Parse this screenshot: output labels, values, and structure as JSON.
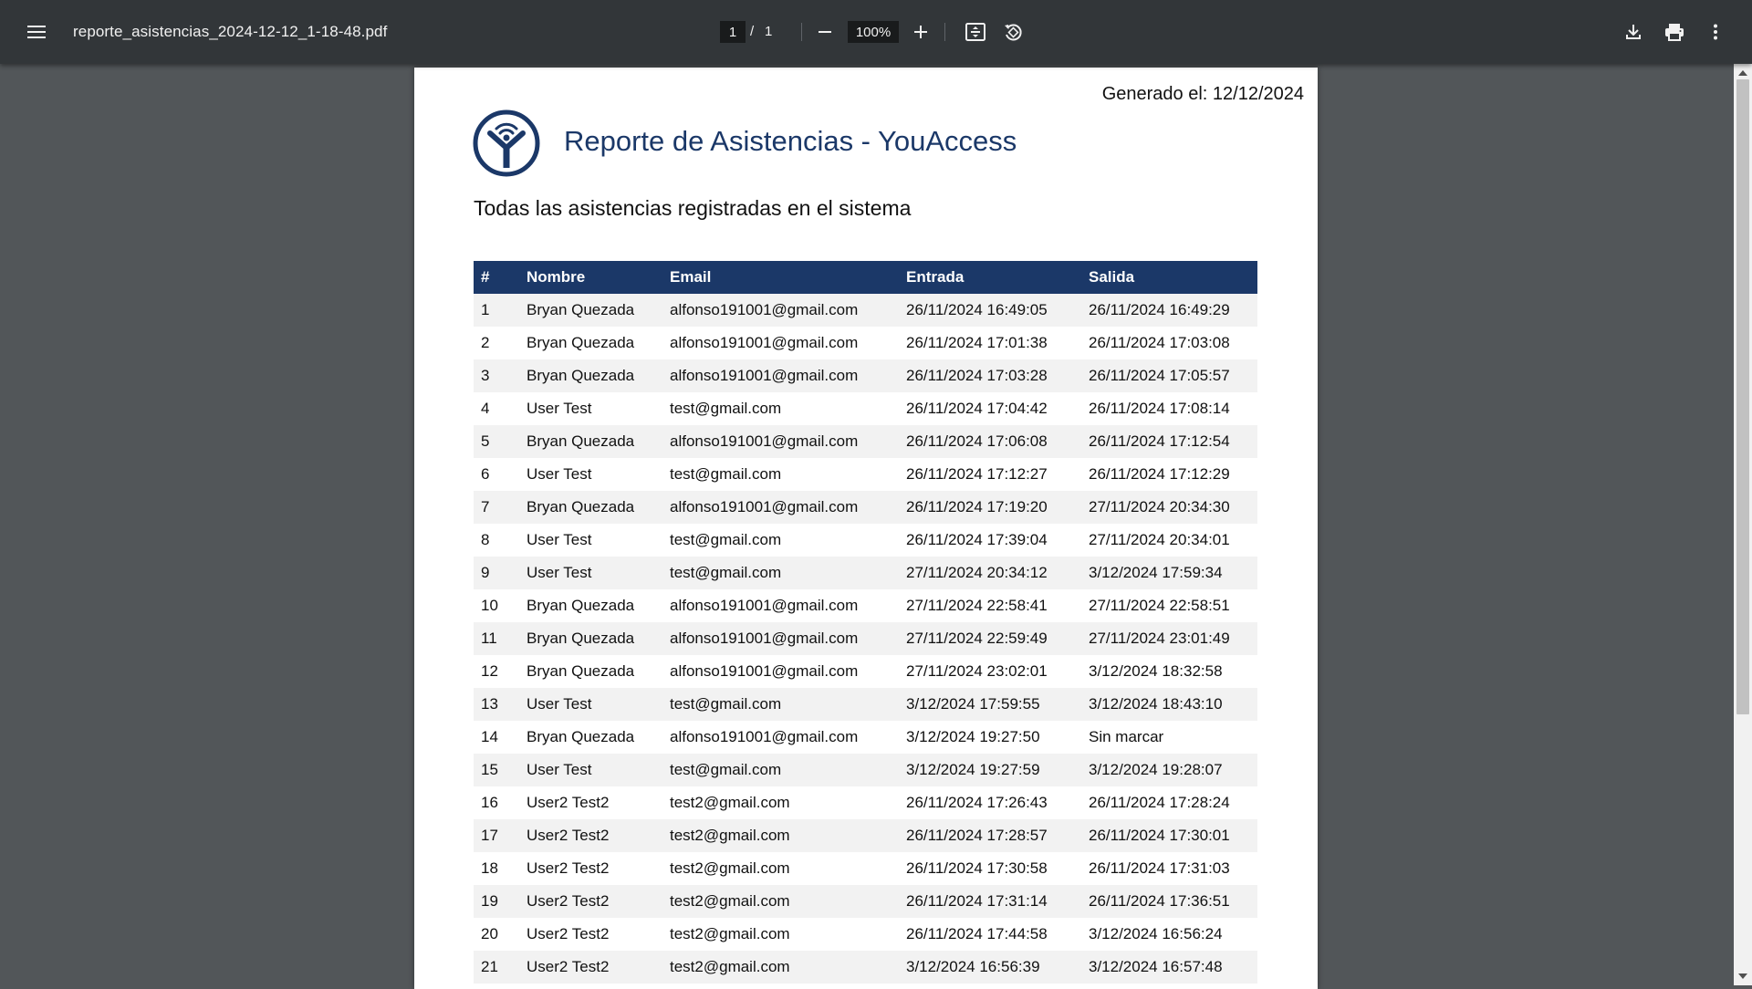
{
  "toolbar": {
    "file_name": "reporte_asistencias_2024-12-12_1-18-48.pdf",
    "current_page": "1",
    "page_separator": "/",
    "total_pages": "1",
    "zoom": "100%"
  },
  "document": {
    "generated": "Generado el: 12/12/2024",
    "title": "Reporte de Asistencias - YouAccess",
    "subtitle": "Todas las asistencias registradas en el sistema",
    "brand_color": "#1b3868",
    "table": {
      "headers": [
        "#",
        "Nombre",
        "Email",
        "Entrada",
        "Salida"
      ],
      "rows": [
        [
          "1",
          "Bryan Quezada",
          "alfonso191001@gmail.com",
          "26/11/2024 16:49:05",
          "26/11/2024 16:49:29"
        ],
        [
          "2",
          "Bryan Quezada",
          "alfonso191001@gmail.com",
          "26/11/2024 17:01:38",
          "26/11/2024 17:03:08"
        ],
        [
          "3",
          "Bryan Quezada",
          "alfonso191001@gmail.com",
          "26/11/2024 17:03:28",
          "26/11/2024 17:05:57"
        ],
        [
          "4",
          "User Test",
          "test@gmail.com",
          "26/11/2024 17:04:42",
          "26/11/2024 17:08:14"
        ],
        [
          "5",
          "Bryan Quezada",
          "alfonso191001@gmail.com",
          "26/11/2024 17:06:08",
          "26/11/2024 17:12:54"
        ],
        [
          "6",
          "User Test",
          "test@gmail.com",
          "26/11/2024 17:12:27",
          "26/11/2024 17:12:29"
        ],
        [
          "7",
          "Bryan Quezada",
          "alfonso191001@gmail.com",
          "26/11/2024 17:19:20",
          "27/11/2024 20:34:30"
        ],
        [
          "8",
          "User Test",
          "test@gmail.com",
          "26/11/2024 17:39:04",
          "27/11/2024 20:34:01"
        ],
        [
          "9",
          "User Test",
          "test@gmail.com",
          "27/11/2024 20:34:12",
          "3/12/2024 17:59:34"
        ],
        [
          "10",
          "Bryan Quezada",
          "alfonso191001@gmail.com",
          "27/11/2024 22:58:41",
          "27/11/2024 22:58:51"
        ],
        [
          "11",
          "Bryan Quezada",
          "alfonso191001@gmail.com",
          "27/11/2024 22:59:49",
          "27/11/2024 23:01:49"
        ],
        [
          "12",
          "Bryan Quezada",
          "alfonso191001@gmail.com",
          "27/11/2024 23:02:01",
          "3/12/2024 18:32:58"
        ],
        [
          "13",
          "User Test",
          "test@gmail.com",
          "3/12/2024 17:59:55",
          "3/12/2024 18:43:10"
        ],
        [
          "14",
          "Bryan Quezada",
          "alfonso191001@gmail.com",
          "3/12/2024 19:27:50",
          "Sin marcar"
        ],
        [
          "15",
          "User Test",
          "test@gmail.com",
          "3/12/2024 19:27:59",
          "3/12/2024 19:28:07"
        ],
        [
          "16",
          "User2 Test2",
          "test2@gmail.com",
          "26/11/2024 17:26:43",
          "26/11/2024 17:28:24"
        ],
        [
          "17",
          "User2 Test2",
          "test2@gmail.com",
          "26/11/2024 17:28:57",
          "26/11/2024 17:30:01"
        ],
        [
          "18",
          "User2 Test2",
          "test2@gmail.com",
          "26/11/2024 17:30:58",
          "26/11/2024 17:31:03"
        ],
        [
          "19",
          "User2 Test2",
          "test2@gmail.com",
          "26/11/2024 17:31:14",
          "26/11/2024 17:36:51"
        ],
        [
          "20",
          "User2 Test2",
          "test2@gmail.com",
          "26/11/2024 17:44:58",
          "3/12/2024 16:56:24"
        ],
        [
          "21",
          "User2 Test2",
          "test2@gmail.com",
          "3/12/2024 16:56:39",
          "3/12/2024 16:57:48"
        ]
      ]
    }
  },
  "icons": {
    "menu": "hamburger-menu-icon",
    "zoom_out": "minus-icon",
    "zoom_in": "plus-icon",
    "fit": "fit-to-page-icon",
    "rotate": "rotate-counterclockwise-icon",
    "download": "download-icon",
    "print": "printer-icon",
    "more": "more-vertical-icon",
    "logo": "youaccess-logo"
  }
}
